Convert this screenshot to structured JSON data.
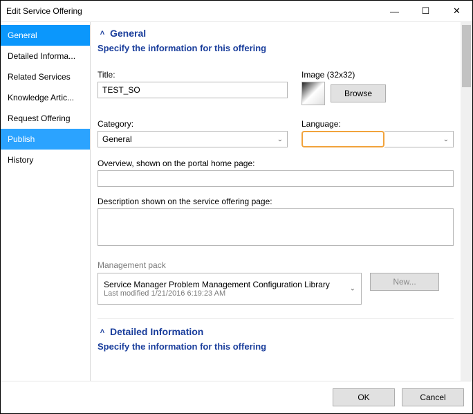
{
  "window": {
    "title": "Edit Service Offering",
    "min": "—",
    "max": "☐",
    "close": "✕"
  },
  "sidebar": {
    "items": [
      {
        "label": "General"
      },
      {
        "label": "Detailed Informa..."
      },
      {
        "label": "Related Services"
      },
      {
        "label": "Knowledge Artic..."
      },
      {
        "label": "Request Offering"
      },
      {
        "label": "Publish"
      },
      {
        "label": "History"
      }
    ]
  },
  "general": {
    "header": "General",
    "sub": "Specify the information for this offering",
    "title_label": "Title:",
    "title_value": "TEST_SO",
    "image_label": "Image (32x32)",
    "browse": "Browse",
    "category_label": "Category:",
    "category_value": "General",
    "language_label": "Language:",
    "language_value": "",
    "overview_label": "Overview, shown on the portal home page:",
    "overview_value": "",
    "description_label": "Description shown on the service offering page:",
    "description_value": "",
    "mp_label": "Management pack",
    "mp_value": "Service Manager Problem Management Configuration Library",
    "mp_modified": "Last modified  1/21/2016 6:19:23 AM",
    "new_btn": "New..."
  },
  "detailed": {
    "header": "Detailed Information",
    "sub": "Specify the information for this offering"
  },
  "footer": {
    "ok": "OK",
    "cancel": "Cancel"
  }
}
